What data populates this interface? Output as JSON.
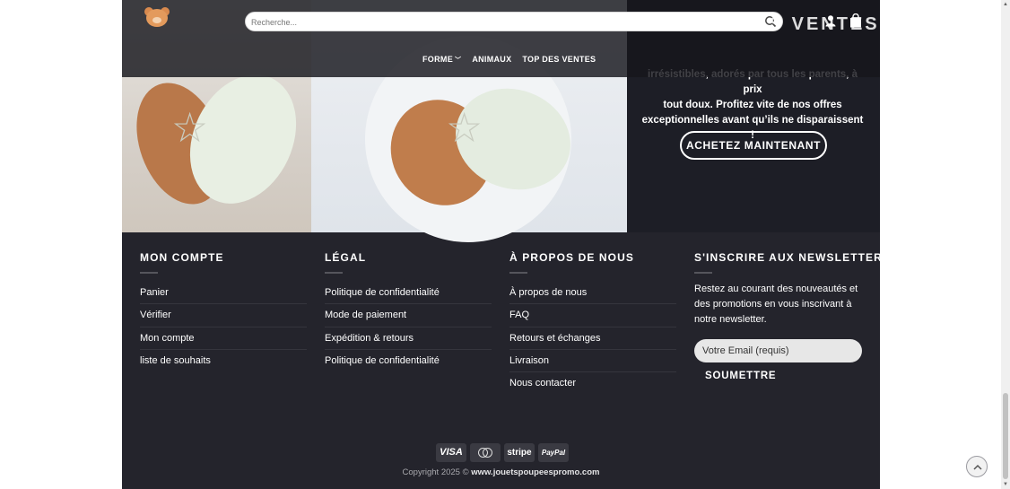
{
  "header": {
    "search_placeholder": "Recherche...",
    "hero_title": "TOP DES VENTES"
  },
  "nav": {
    "items": [
      {
        "label": "FORME",
        "has_dropdown": true
      },
      {
        "label": "ANIMAUX"
      },
      {
        "label": "TOP DES VENTES"
      }
    ]
  },
  "hero": {
    "line1": "irrésistibles, adorés par tous les parents, à prix",
    "line2": "tout doux. Profitez vite de nos offres",
    "line3": "exceptionnelles avant qu’ils ne disparaissent !",
    "button": "Achetez maintenant"
  },
  "footer": {
    "col1": {
      "title": "MON COMPTE",
      "links": [
        "Panier",
        "Vérifier",
        "Mon compte",
        "liste de souhaits"
      ]
    },
    "col2": {
      "title": "LÉGAL",
      "links": [
        "Politique de confidentialité",
        "Mode de paiement",
        "Expédition & retours",
        "Politique de confidentialité"
      ]
    },
    "col3": {
      "title": "À PROPOS DE NOUS",
      "links": [
        "À propos de nous",
        "FAQ",
        "Retours et échanges",
        "Livraison",
        "Nous contacter"
      ]
    },
    "col4": {
      "title": "S'INSCRIRE AUX NEWSLETTERS",
      "text": "Restez au courant des nouveautés et des promotions en vous inscrivant à notre newsletter.",
      "email_placeholder": "Votre Email (requis)",
      "submit": "Soumettre"
    },
    "payments": [
      "VISA",
      "mastercard",
      "stripe",
      "PayPal"
    ],
    "copyright_prefix": "Copyright 2025 ©",
    "copyright_site": "www.jouetspoupeespromo.com"
  },
  "colors": {
    "footer_bg": "#24242c",
    "header_bg": "#16161c",
    "text": "#ffffff"
  },
  "icons": [
    "search-icon",
    "user-icon",
    "cart-icon",
    "chevron-down-icon",
    "back-to-top-icon"
  ]
}
